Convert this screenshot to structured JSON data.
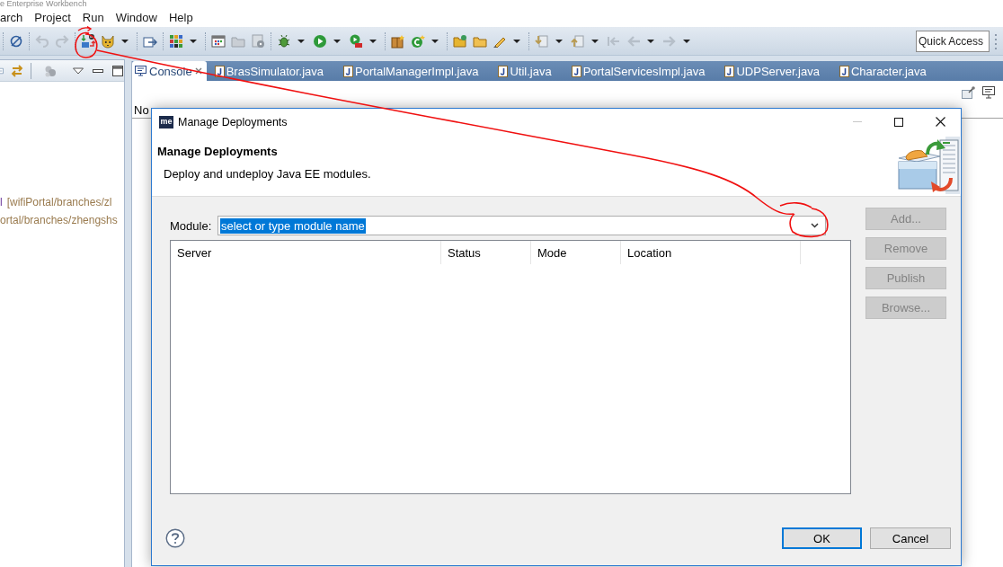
{
  "window": {
    "title": "e Enterprise Workbench"
  },
  "menu": [
    "arch",
    "Project",
    "Run",
    "Window",
    "Help"
  ],
  "toolbar": {
    "quick_access": {
      "placeholder": "Quick Access"
    }
  },
  "left_panel": {
    "lines": [
      {
        "marker": "l",
        "text": "[wifiPortal/branches/zl"
      },
      {
        "text": "ortal/branches/zhengshs"
      }
    ]
  },
  "editor_tabs": [
    {
      "label": "Console",
      "kind": "console",
      "selected": true
    },
    {
      "label": "BrasSimulator.java",
      "kind": "java",
      "selected": false
    },
    {
      "label": "PortalManagerImpl.java",
      "kind": "java",
      "selected": false
    },
    {
      "label": "Util.java",
      "kind": "java",
      "selected": false
    },
    {
      "label": "PortalServicesImpl.java",
      "kind": "java",
      "selected": false
    },
    {
      "label": "UDPServer.java",
      "kind": "java",
      "selected": false
    },
    {
      "label": "Character.java",
      "kind": "java",
      "selected": false
    }
  ],
  "console": {
    "text": "No"
  },
  "dialog": {
    "logo": "me",
    "title": "Manage Deployments",
    "heading": "Manage Deployments",
    "description": "Deploy and undeploy Java EE modules.",
    "module": {
      "label": "Module:",
      "value": "select or type module name",
      "text_selected": true
    },
    "table": {
      "columns": [
        "Server",
        "Status",
        "Mode",
        "Location"
      ]
    },
    "side_buttons": [
      {
        "label": "Add...",
        "disabled": true
      },
      {
        "label": "Remove",
        "disabled": true
      },
      {
        "label": "Publish",
        "disabled": true
      },
      {
        "label": "Browse...",
        "disabled": true
      }
    ],
    "buttons": [
      {
        "label": "OK",
        "default": true
      },
      {
        "label": "Cancel",
        "default": false
      }
    ]
  }
}
